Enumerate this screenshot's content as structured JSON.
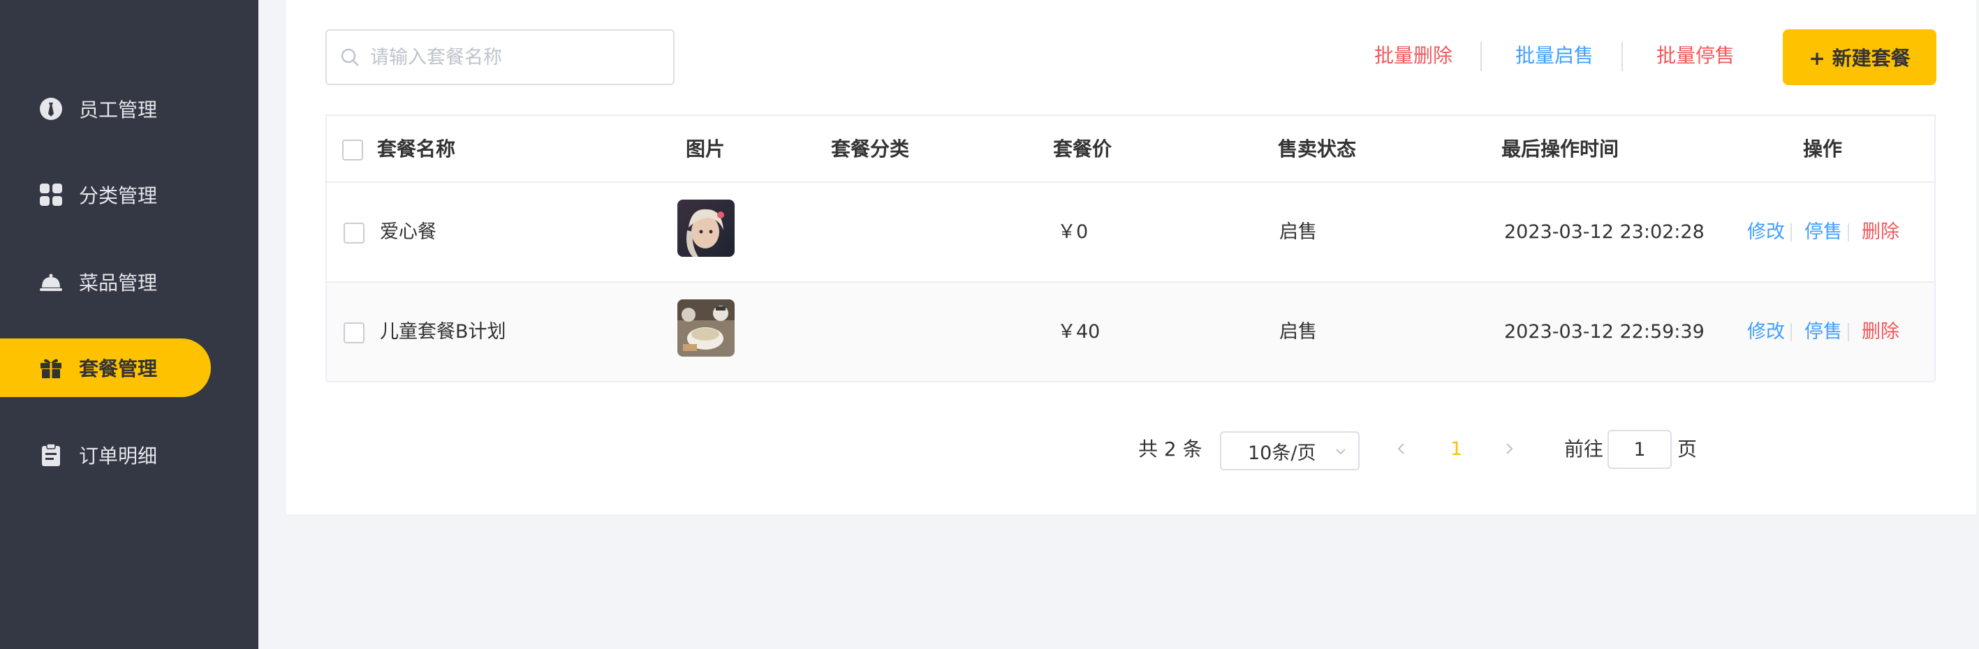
{
  "sidebar": {
    "items": [
      {
        "label": "员工管理",
        "icon": "employee-tie-icon",
        "active": false
      },
      {
        "label": "分类管理",
        "icon": "category-grid-icon",
        "active": false
      },
      {
        "label": "菜品管理",
        "icon": "dish-cloche-icon",
        "active": false
      },
      {
        "label": "套餐管理",
        "icon": "gift-icon",
        "active": true
      },
      {
        "label": "订单明细",
        "icon": "clipboard-icon",
        "active": false
      }
    ]
  },
  "toolbar": {
    "search_placeholder": "请输入套餐名称",
    "search_value": "",
    "batch_delete": "批量删除",
    "batch_enable": "批量启售",
    "batch_disable": "批量停售",
    "add_label": "+ 新建套餐"
  },
  "table": {
    "headers": {
      "name": "套餐名称",
      "image": "图片",
      "category": "套餐分类",
      "price": "套餐价",
      "status": "售卖状态",
      "updated": "最后操作时间",
      "actions": "操作"
    },
    "rows": [
      {
        "name": "爱心餐",
        "category": "",
        "price": "￥0",
        "status": "启售",
        "updated": "2023-03-12 23:02:28",
        "edit": "修改",
        "toggle": "停售",
        "delete": "删除"
      },
      {
        "name": "儿童套餐B计划",
        "category": "",
        "price": "￥40",
        "status": "启售",
        "updated": "2023-03-12 22:59:39",
        "edit": "修改",
        "toggle": "停售",
        "delete": "删除"
      }
    ]
  },
  "pagination": {
    "total_label": "共 2 条",
    "page_size": "10条/页",
    "current_page": "1",
    "goto_prefix": "前往",
    "goto_value": "1",
    "goto_suffix": "页"
  },
  "colors": {
    "sidebar_bg": "#343744",
    "accent": "#ffc200",
    "link_blue": "#419eff",
    "link_red": "#f2575b"
  }
}
